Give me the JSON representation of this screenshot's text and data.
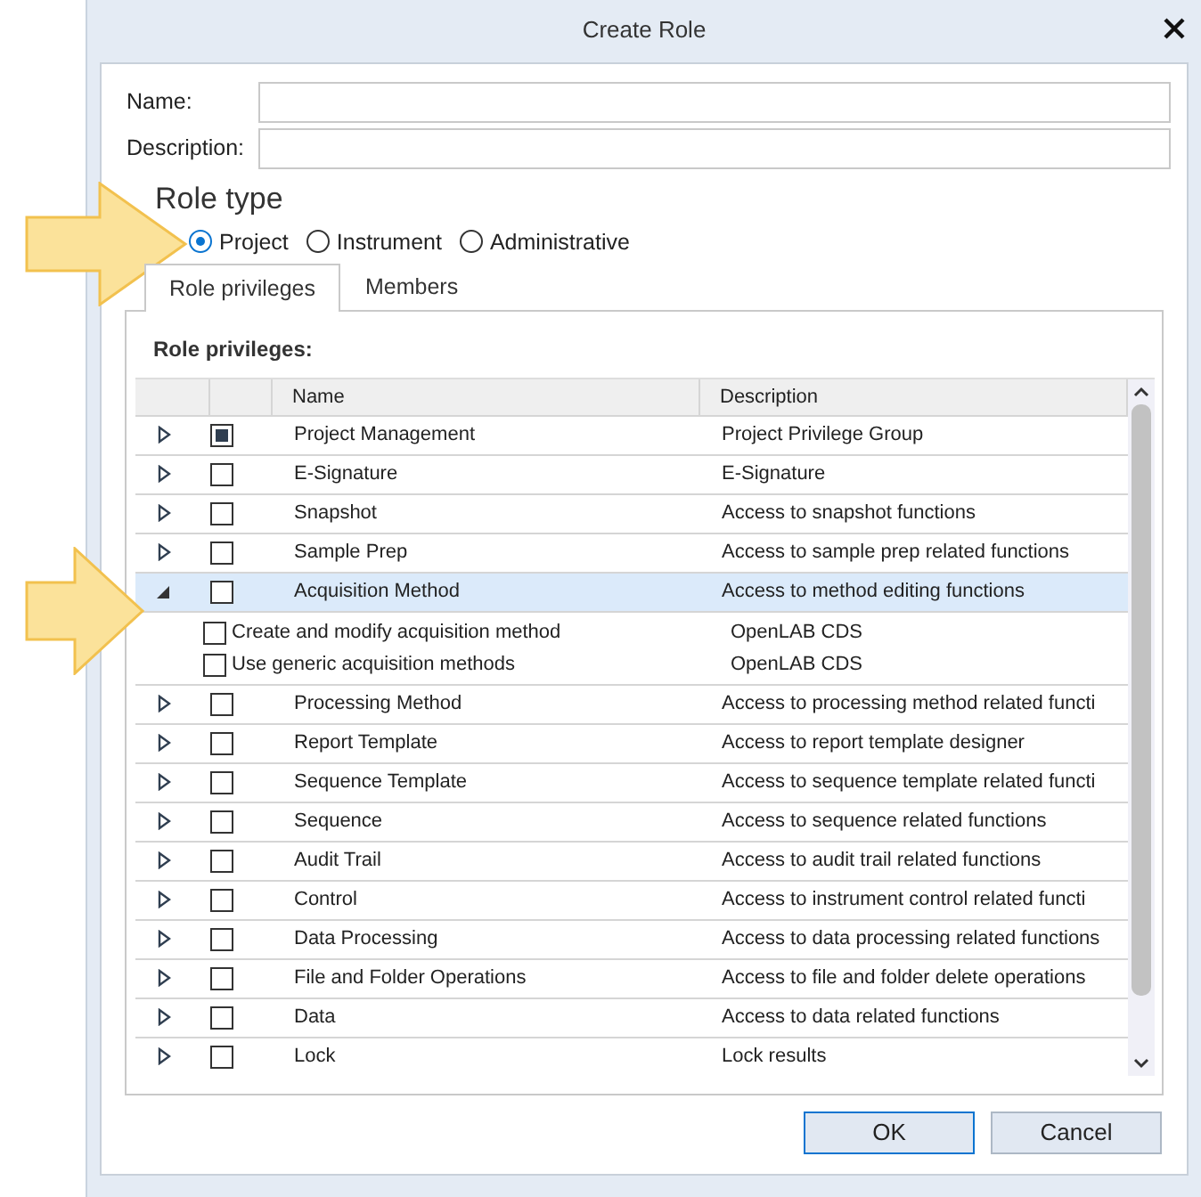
{
  "window": {
    "title": "Create Role"
  },
  "fields": [
    {
      "label": "Name:"
    },
    {
      "label": "Description:"
    }
  ],
  "role_type": {
    "heading": "Role type",
    "options": [
      {
        "label": "Project",
        "selected": true
      },
      {
        "label": "Instrument",
        "selected": false
      },
      {
        "label": "Administrative",
        "selected": false
      }
    ]
  },
  "tabs": [
    {
      "label": "Role privileges",
      "selected": true
    },
    {
      "label": "Members",
      "selected": false
    }
  ],
  "privileges": {
    "heading": "Role privileges:",
    "columns": [
      "Name",
      "Description"
    ],
    "rows": [
      {
        "name": "Project Management",
        "description": "Project Privilege Group",
        "checked": false,
        "indeterminate": true,
        "expanded": false,
        "selected": false
      },
      {
        "name": "E-Signature",
        "description": "E-Signature",
        "checked": false,
        "indeterminate": false,
        "expanded": false,
        "selected": false
      },
      {
        "name": "Snapshot",
        "description": "Access to snapshot functions",
        "checked": false,
        "indeterminate": false,
        "expanded": false,
        "selected": false
      },
      {
        "name": "Sample Prep",
        "description": "Access to sample prep related functions",
        "checked": false,
        "indeterminate": false,
        "expanded": false,
        "selected": false
      },
      {
        "name": "Acquisition Method",
        "description": "Access to method editing functions",
        "checked": false,
        "indeterminate": false,
        "expanded": true,
        "selected": true,
        "children": [
          {
            "name": "Create and modify acquisition method",
            "description": "OpenLAB CDS",
            "checked": false
          },
          {
            "name": "Use generic acquisition methods",
            "description": "OpenLAB CDS",
            "checked": false
          }
        ]
      },
      {
        "name": "Processing Method",
        "description": "Access to processing method related functi",
        "checked": false,
        "indeterminate": false,
        "expanded": false,
        "selected": false
      },
      {
        "name": "Report Template",
        "description": "Access to report template designer",
        "checked": false,
        "indeterminate": false,
        "expanded": false,
        "selected": false
      },
      {
        "name": "Sequence Template",
        "description": "Access to sequence template related functi",
        "checked": false,
        "indeterminate": false,
        "expanded": false,
        "selected": false
      },
      {
        "name": "Sequence",
        "description": "Access to sequence related functions",
        "checked": false,
        "indeterminate": false,
        "expanded": false,
        "selected": false
      },
      {
        "name": "Audit Trail",
        "description": "Access to audit trail related functions",
        "checked": false,
        "indeterminate": false,
        "expanded": false,
        "selected": false
      },
      {
        "name": "Control",
        "description": "Access to instrument control related functi",
        "checked": false,
        "indeterminate": false,
        "expanded": false,
        "selected": false
      },
      {
        "name": "Data Processing",
        "description": "Access to data processing related functions",
        "checked": false,
        "indeterminate": false,
        "expanded": false,
        "selected": false
      },
      {
        "name": "File and Folder Operations",
        "description": "Access to file and folder delete operations",
        "checked": false,
        "indeterminate": false,
        "expanded": false,
        "selected": false
      },
      {
        "name": "Data",
        "description": "Access to data related functions",
        "checked": false,
        "indeterminate": false,
        "expanded": false,
        "selected": false
      },
      {
        "name": "Lock",
        "description": "Lock results",
        "checked": false,
        "indeterminate": false,
        "expanded": false,
        "selected": false
      }
    ]
  },
  "buttons": [
    {
      "label": "OK",
      "default": true
    },
    {
      "label": "Cancel",
      "default": false
    }
  ]
}
